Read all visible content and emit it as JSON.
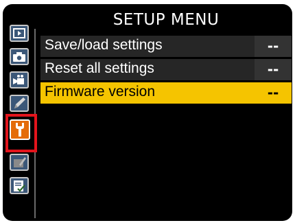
{
  "title": "SETUP MENU",
  "sidebar": {
    "tabs": [
      {
        "name": "playback-menu",
        "icon": "playback-icon",
        "active": false
      },
      {
        "name": "photo-shooting-menu",
        "icon": "camera-icon",
        "active": false
      },
      {
        "name": "movie-shooting-menu",
        "icon": "movie-camera-icon",
        "active": false
      },
      {
        "name": "custom-settings-menu",
        "icon": "pencil-icon",
        "active": false
      },
      {
        "name": "setup-menu",
        "icon": "wrench-icon",
        "active": true
      },
      {
        "name": "retouch-menu",
        "icon": "retouch-brush-icon",
        "active": false
      },
      {
        "name": "my-menu",
        "icon": "recent-settings-icon",
        "active": false
      }
    ]
  },
  "menu": {
    "items": [
      {
        "label": "Save/load settings",
        "value": "--",
        "selected": false
      },
      {
        "label": "Reset all settings",
        "value": "--",
        "selected": false
      },
      {
        "label": "Firmware version",
        "value": "--",
        "selected": true
      }
    ]
  },
  "colors": {
    "selected_row": "#f5c400",
    "active_tab": "#e46c0a",
    "highlight_box": "#e3141c"
  }
}
